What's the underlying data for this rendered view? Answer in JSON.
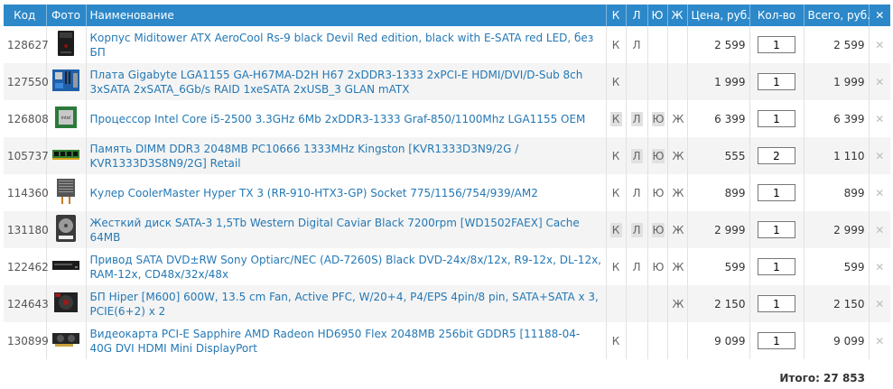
{
  "header": {
    "code": "Код",
    "photo": "Фото",
    "name": "Наименование",
    "k": "К",
    "l": "Л",
    "yu": "Ю",
    "zh": "Ж",
    "price": "Цена, руб.",
    "qty": "Кол-во",
    "total": "Всего, руб.",
    "close": "✕"
  },
  "rows": [
    {
      "code": "128627",
      "thumb": "case-icon",
      "name": "Корпус Miditower ATX AeroCool Rs-9 black Devil Red edition, black with E-SATA red LED, без БП",
      "k": "К",
      "l": "Л",
      "yu": "",
      "zh": "",
      "k_on": false,
      "l_on": false,
      "yu_on": false,
      "price": "2 599",
      "qty": "1",
      "total": "2 599"
    },
    {
      "code": "127550",
      "thumb": "motherboard-icon",
      "name": "Плата Gigabyte LGA1155 GA-H67MA-D2H H67 2xDDR3-1333 2xPCI-E HDMI/DVI/D-Sub 8ch 3xSATA 2xSATA_6Gb/s RAID 1xeSATA 2xUSB_3 GLAN mATX",
      "k": "К",
      "l": "",
      "yu": "",
      "zh": "",
      "k_on": false,
      "l_on": false,
      "yu_on": false,
      "price": "1 999",
      "qty": "1",
      "total": "1 999"
    },
    {
      "code": "126808",
      "thumb": "cpu-icon",
      "name": "Процессор Intel Core i5-2500 3.3GHz 6Mb 2xDDR3-1333 Graf-850/1100Mhz LGA1155 OEM",
      "k": "К",
      "l": "Л",
      "yu": "Ю",
      "zh": "Ж",
      "k_on": true,
      "l_on": true,
      "yu_on": true,
      "price": "6 399",
      "qty": "1",
      "total": "6 399"
    },
    {
      "code": "105737",
      "thumb": "memory-icon",
      "name": "Память DIMM DDR3 2048MB PC10666 1333MHz Kingston [KVR1333D3N9/2G / KVR1333D3S8N9/2G] Retail",
      "k": "К",
      "l": "Л",
      "yu": "Ю",
      "zh": "Ж",
      "k_on": false,
      "l_on": true,
      "yu_on": true,
      "price": "555",
      "qty": "2",
      "total": "1 110"
    },
    {
      "code": "114360",
      "thumb": "cooler-icon",
      "name": "Кулер CoolerMaster Hyper TX 3 (RR-910-HTX3-GP) Socket 775/1156/754/939/AM2",
      "k": "К",
      "l": "Л",
      "yu": "Ю",
      "zh": "Ж",
      "k_on": false,
      "l_on": false,
      "yu_on": false,
      "price": "899",
      "qty": "1",
      "total": "899"
    },
    {
      "code": "131180",
      "thumb": "hdd-icon",
      "name": "Жесткий диск SATA-3 1,5Tb Western Digital Caviar Black 7200rpm [WD1502FAEX] Cache 64MB",
      "k": "К",
      "l": "Л",
      "yu": "Ю",
      "zh": "Ж",
      "k_on": true,
      "l_on": true,
      "yu_on": true,
      "price": "2 999",
      "qty": "1",
      "total": "2 999"
    },
    {
      "code": "122462",
      "thumb": "dvd-icon",
      "name": "Привод SATA DVD±RW Sony Optiarc/NEC (AD-7260S) Black DVD-24x/8x/12x, R9-12x, DL-12x, RAM-12x, CD48x/32x/48x",
      "k": "К",
      "l": "Л",
      "yu": "Ю",
      "zh": "Ж",
      "k_on": false,
      "l_on": false,
      "yu_on": false,
      "price": "599",
      "qty": "1",
      "total": "599"
    },
    {
      "code": "124643",
      "thumb": "psu-icon",
      "name": "БП Hiper [M600] 600W, 13.5 cm Fan, Active PFC, W/20+4, P4/EPS 4pin/8 pin, SATA+SATA x 3, PCIE(6+2) x 2",
      "k": "",
      "l": "",
      "yu": "",
      "zh": "Ж",
      "k_on": false,
      "l_on": false,
      "yu_on": false,
      "price": "2 150",
      "qty": "1",
      "total": "2 150"
    },
    {
      "code": "130899",
      "thumb": "gpu-icon",
      "name": "Видеокарта PCI-E Sapphire AMD Radeon HD6950 Flex 2048MB 256bit GDDR5 [11188-04-40G DVI HDMI Mini DisplayPort",
      "k": "К",
      "l": "",
      "yu": "",
      "zh": "",
      "k_on": false,
      "l_on": false,
      "yu_on": false,
      "price": "9 099",
      "qty": "1",
      "total": "9 099"
    }
  ],
  "summary": {
    "text": "Итого: 27 853"
  },
  "colors": {
    "header_bg": "#2c88c9",
    "link": "#2478b5",
    "row_alt": "#f4f4f4"
  }
}
